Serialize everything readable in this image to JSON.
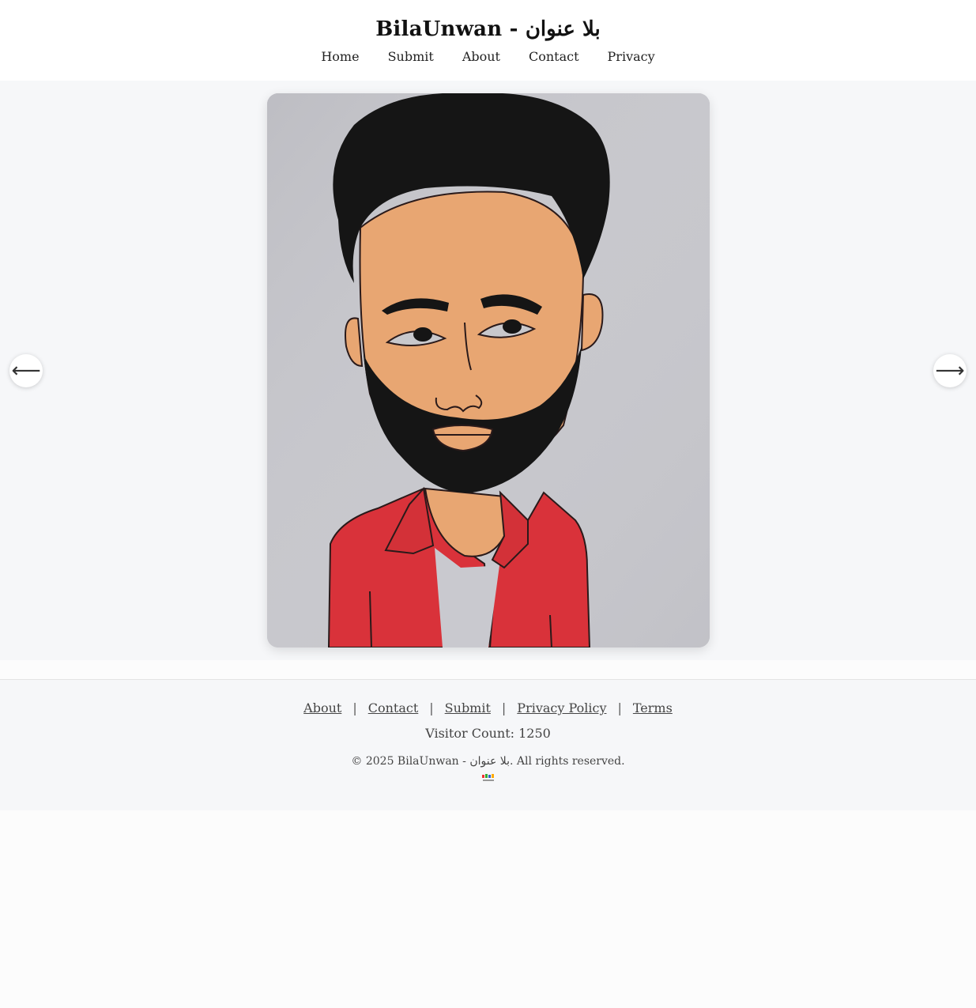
{
  "header": {
    "title": "BilaUnwan - بلا عنوان",
    "nav": [
      "Home",
      "Submit",
      "About",
      "Contact",
      "Privacy"
    ]
  },
  "gallery": {
    "prev_label": "⟵",
    "next_label": "⟶",
    "image_subject": "hand-drawn portrait of a bearded man in a red shirt"
  },
  "footer": {
    "links": [
      "About",
      "Contact",
      "Submit",
      "Privacy Policy",
      "Terms"
    ],
    "separator": "|",
    "visitor_count": "Visitor Count: 1250",
    "copyright": "© 2025 BilaUnwan - بلا عنوان. All rights reserved."
  },
  "colors": {
    "page_bg": "#f6f7f9",
    "paper": "#c5c5ca",
    "skin": "#e8a672",
    "hair": "#141414",
    "shirt": "#d9323a"
  }
}
